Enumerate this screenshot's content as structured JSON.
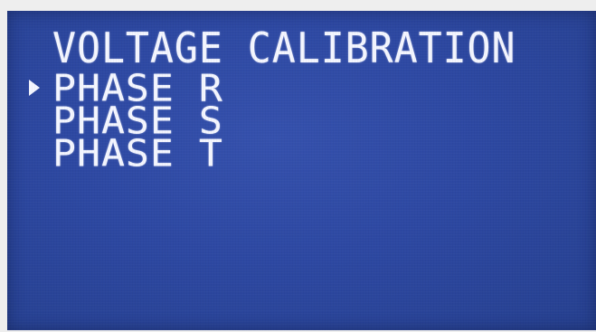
{
  "screen": {
    "title": "VOLTAGE CALIBRATION",
    "selection_marker": "triangle-right-icon",
    "items": [
      {
        "label": "PHASE R",
        "selected": true
      },
      {
        "label": "PHASE S",
        "selected": false
      },
      {
        "label": "PHASE T",
        "selected": false
      }
    ]
  },
  "colors": {
    "background": "#2d48a2",
    "text": "#f4f6ff"
  }
}
